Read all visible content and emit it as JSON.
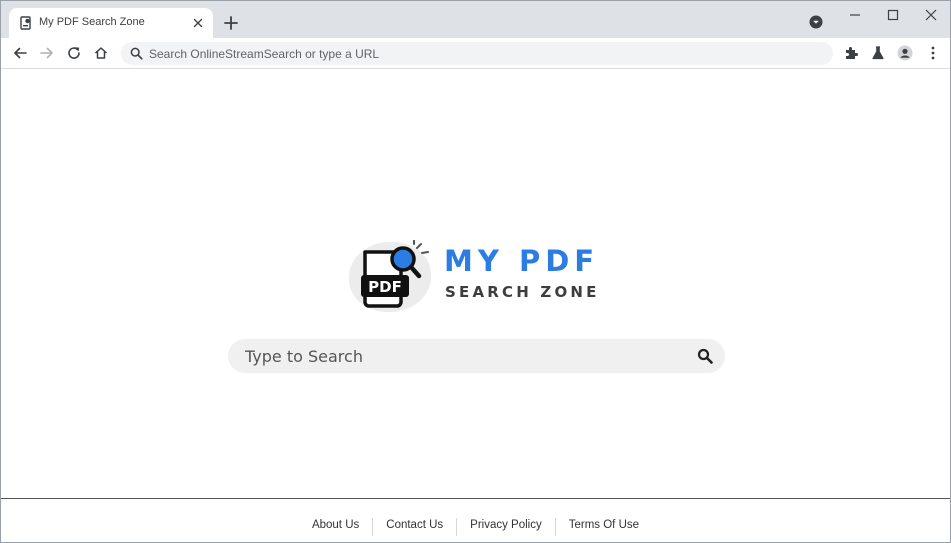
{
  "tab": {
    "title": "My PDF Search Zone",
    "favicon": "document-favicon-icon"
  },
  "omnibox": {
    "placeholder": "Search OnlineStreamSearch or type a URL"
  },
  "logo": {
    "line1": "MY PDF",
    "line2": "SEARCH ZONE",
    "badge_text": "PDF",
    "colors": {
      "accent": "#2b7de4",
      "dark": "#3d3d3d"
    }
  },
  "search": {
    "placeholder": "Type to Search"
  },
  "footer": {
    "links": [
      "About Us",
      "Contact Us",
      "Privacy Policy",
      "Terms Of Use"
    ]
  }
}
